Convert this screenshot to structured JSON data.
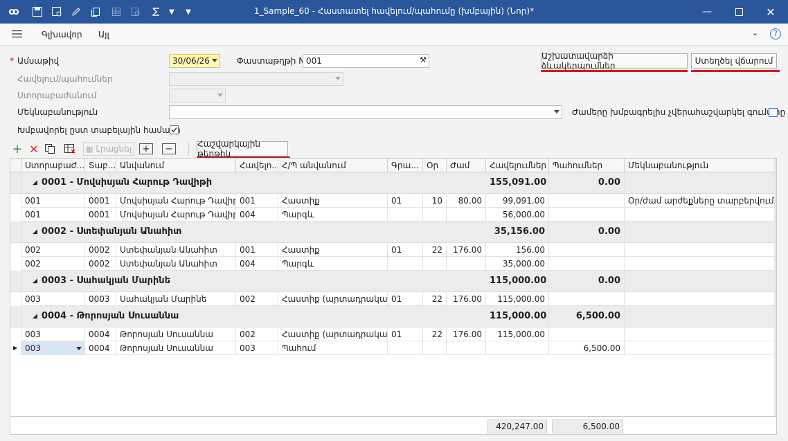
{
  "window": {
    "title": "1_Sample_60 - Հաստատել հավելում/պահումը (խմբային) (Նոր)*"
  },
  "menu": {
    "main": "Գլխավոր",
    "other": "Այլ"
  },
  "form": {
    "date_label": "Ամսաթիվ",
    "date_value": "30/06/26",
    "doc_label": "Փաստաթղթի N",
    "doc_value": "001",
    "addition_label": "Հավելում/պահումներ",
    "subdivision_label": "Ստորաբաժանում",
    "comment_label": "Մեկնաբանություն",
    "hours_label": "Ժամերը խմբագրելիս չվերահաշվարկել գումարը",
    "group_label": "Խմբավորել ըստ տաբելային համարի"
  },
  "buttons": {
    "work_shifts": "Աշխատավարձի ձևակերպումներ",
    "create_payment": "Ստեղծել վճարում",
    "fill": "Լրացնել",
    "calc_sheet": "Հաշվարկային թերթիկ"
  },
  "columns": [
    "Ստորաբաժ...",
    "Տաբ...",
    "Անվանում",
    "Հավելո...",
    "Հ/Պ անվանում",
    "Գրա...",
    "Օր",
    "Ժամ",
    "Հավելումներ",
    "Պահումներ",
    "Մեկնաբանություն"
  ],
  "groups": [
    {
      "title": "0001 - Մովսիսյան Հարութ Դավիթի",
      "additions": "155,091.00",
      "deductions": "0.00",
      "rows": [
        [
          "001",
          "0001",
          "Մովսիսյան Հարութ Դավիթի",
          "001",
          "Հաստիք",
          "01",
          "10",
          "80.00",
          "99,091.00",
          "",
          "Օր/ժամ արժեքները տարբերվում..."
        ],
        [
          "001",
          "0001",
          "Մովսիսյան Հարութ Դավիթի",
          "004",
          "Պարգև",
          "",
          "",
          "",
          "56,000.00",
          "",
          ""
        ]
      ]
    },
    {
      "title": "0002 - Ստեփանյան Անահիտ",
      "additions": "35,156.00",
      "deductions": "0.00",
      "rows": [
        [
          "002",
          "0002",
          "Ստեփանյան Անահիտ",
          "001",
          "Հաստիք",
          "01",
          "22",
          "176.00",
          "156.00",
          "",
          ""
        ],
        [
          "002",
          "0002",
          "Ստեփանյան Անահիտ",
          "004",
          "Պարգև",
          "",
          "",
          "",
          "35,000.00",
          "",
          ""
        ]
      ]
    },
    {
      "title": "0003 - Սահակյան Մարինե",
      "additions": "115,000.00",
      "deductions": "0.00",
      "rows": [
        [
          "003",
          "0003",
          "Սահակյան Մարինե",
          "002",
          "Հաստիք (արտադրական)",
          "01",
          "22",
          "176.00",
          "115,000.00",
          "",
          ""
        ]
      ]
    },
    {
      "title": "0004 - Թորոսյան Սուսաննա",
      "additions": "115,000.00",
      "deductions": "6,500.00",
      "rows": [
        [
          "003",
          "0004",
          "Թորոսյան Սուսաննա",
          "002",
          "Հաստիք (արտադրական)",
          "01",
          "22",
          "176.00",
          "115,000.00",
          "",
          ""
        ],
        [
          "003",
          "0004",
          "Թորոսյան Սուսաննա",
          "003",
          "Պահում",
          "",
          "",
          "",
          "",
          "6,500.00",
          ""
        ]
      ]
    }
  ],
  "totals": {
    "additions": "420,247.00",
    "deductions": "6,500.00"
  }
}
